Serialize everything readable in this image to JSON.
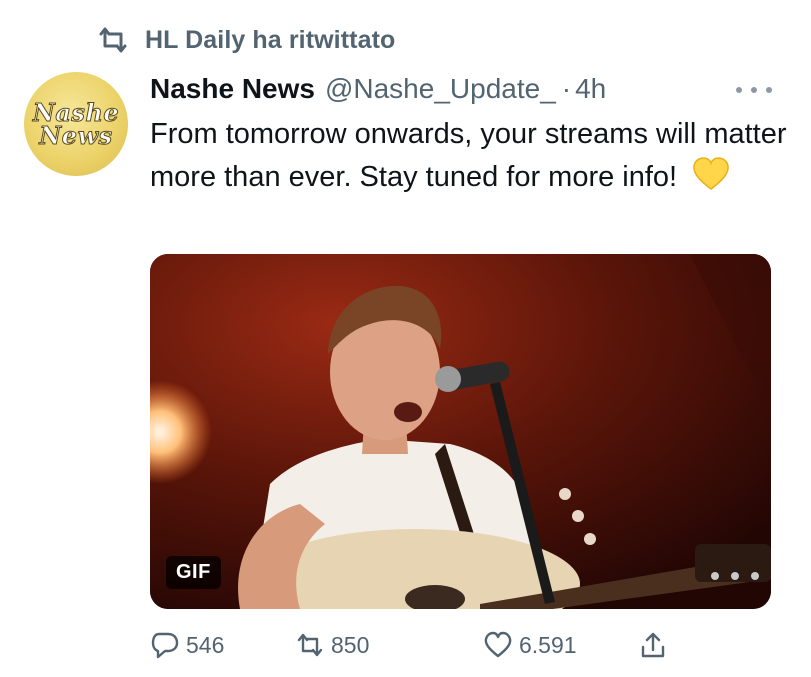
{
  "retweet": {
    "text": "HL Daily ha ritwittato"
  },
  "avatar": {
    "line1": "Nashe",
    "line2": "News"
  },
  "tweet": {
    "name": "Nashe News",
    "handle": "@Nashe_Update_",
    "separator": "·",
    "time": "4h",
    "text": "From tomorrow onwards, your streams will matter more than ever. Stay tuned for more info!"
  },
  "media": {
    "badge": "GIF"
  },
  "actions": {
    "replies": "546",
    "retweets": "850",
    "likes": "6.591"
  },
  "colors": {
    "secondary": "#536471",
    "primary_text": "#0f1419",
    "avatar_gold": "#ecd36a"
  }
}
